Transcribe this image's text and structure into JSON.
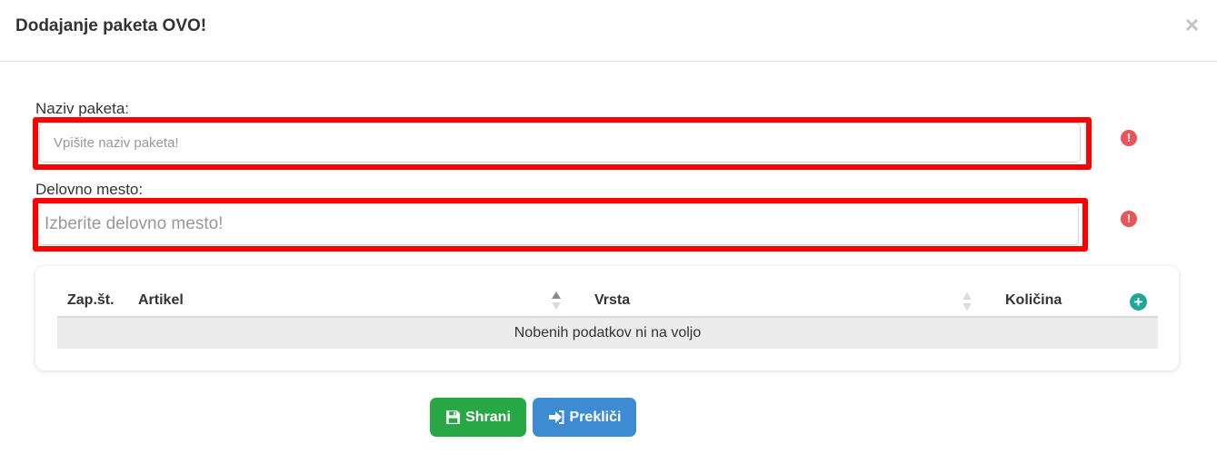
{
  "dialog": {
    "title": "Dodajanje paketa OVO!",
    "close_symbol": "×"
  },
  "form": {
    "name_label": "Naziv paketa:",
    "name_placeholder": "Vpišite naziv paketa!",
    "workplace_label": "Delovno mesto:",
    "workplace_placeholder": "Izberite delovno mesto!",
    "warning_symbol": "!"
  },
  "table": {
    "columns": [
      "Zap.št.",
      "Artikel",
      "Vrsta",
      "Količina"
    ],
    "add_symbol": "+",
    "empty_message": "Nobenih podatkov ni na voljo"
  },
  "buttons": {
    "save_label": "Shrani",
    "cancel_label": "Prekliči"
  },
  "colors": {
    "validation_highlight": "#ff0000",
    "warning": "#e9555a",
    "add": "#1fa89a",
    "save": "#28a745",
    "cancel": "#3d8bd3"
  },
  "icons": {
    "close": "close-icon",
    "warning": "exclamation-circle-icon",
    "add": "plus-circle-icon",
    "save": "floppy-disk-icon",
    "cancel": "sign-out-icon"
  }
}
